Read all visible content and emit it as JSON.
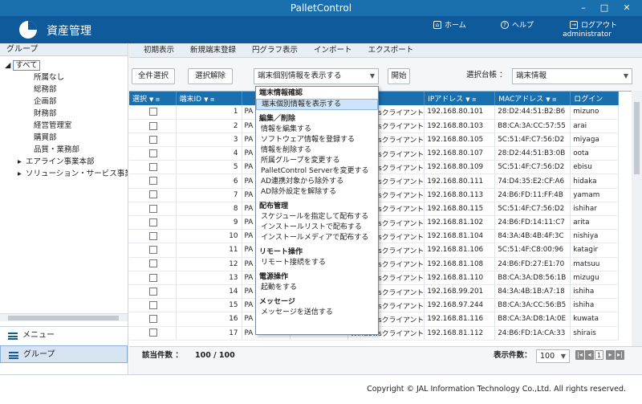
{
  "window": {
    "title": "PalletControl",
    "minimize": "–",
    "maximize": "□",
    "close": "✕"
  },
  "header": {
    "app_title": "資産管理",
    "home": "ホーム",
    "help": "ヘルプ",
    "logout": "ログアウト",
    "user": "administrator"
  },
  "sidebar": {
    "title": "グループ",
    "tree_root": "すべて",
    "children": [
      "所属なし",
      "総務部",
      "企画部",
      "財務部",
      "経営管理室",
      "購買部",
      "品質・業務部"
    ],
    "expandable": [
      "エアライン事業本部",
      "ソリューション・サービス事業本部"
    ],
    "menu_label": "メニュー",
    "group_label": "グループ"
  },
  "menubar": [
    "初期表示",
    "新規端末登録",
    "円グラフ表示",
    "インポート",
    "エクスポート"
  ],
  "toolbar": {
    "select_all": "全件選択",
    "deselect": "選択解除",
    "action_combo": "端末個別情報を表示する",
    "start": "開始",
    "ledger_label": "選択台帳 ：",
    "ledger_value": "端末情報"
  },
  "grid": {
    "headers": [
      "選択",
      "端末ID",
      "",
      "",
      "種別",
      "IPアドレス",
      "MACアドレス",
      "ログイン"
    ],
    "rows": [
      {
        "id": "1",
        "a": "PA",
        "type": "Windowsクライアント",
        "ip": "192.168.80.101",
        "mac": "28:D2:44:51:B2:B6",
        "login": "mizuno"
      },
      {
        "id": "2",
        "a": "PA",
        "type": "Windowsクライアント",
        "ip": "192.168.80.103",
        "mac": "B8:CA:3A:CC:57:55",
        "login": "arai"
      },
      {
        "id": "3",
        "a": "PA",
        "type": "Windowsクライアント",
        "ip": "192.168.80.105",
        "mac": "5C:51:4F:C7:56:D2",
        "login": "miyaga"
      },
      {
        "id": "4",
        "a": "PA",
        "type": "Windowsクライアント",
        "ip": "192.168.80.107",
        "mac": "28:D2:44:51:B3:0B",
        "login": "oota"
      },
      {
        "id": "5",
        "a": "PA",
        "type": "Windowsクライアント",
        "ip": "192.168.80.109",
        "mac": "5C:51:4F:C7:56:D2",
        "login": "ebisu"
      },
      {
        "id": "6",
        "a": "PA",
        "type": "Windowsクライアント",
        "ip": "192.168.80.111",
        "mac": "74:D4:35:E2:CF:A6",
        "login": "hidaka"
      },
      {
        "id": "7",
        "a": "PA",
        "type": "Windowsクライアント",
        "ip": "192.168.80.113",
        "mac": "24:B6:FD:11:FF:4B",
        "login": "yamam"
      },
      {
        "id": "8",
        "a": "PA",
        "type": "Windowsクライアント",
        "ip": "192.168.80.115",
        "mac": "5C:51:4F:C7:56:D2",
        "login": "ishihar"
      },
      {
        "id": "9",
        "a": "PA",
        "type": "Windowsクライアント",
        "ip": "192.168.81.102",
        "mac": "24:B6:FD:14:11:C7",
        "login": "arita"
      },
      {
        "id": "10",
        "a": "PA",
        "type": "Windowsクライアント",
        "ip": "192.168.81.104",
        "mac": "84:3A:4B:4B:4F:3C",
        "login": "nishiya"
      },
      {
        "id": "11",
        "a": "PA",
        "type": "Windowsクライアント",
        "ip": "192.168.81.106",
        "mac": "5C:51:4F:C8:00:96",
        "login": "katagir"
      },
      {
        "id": "12",
        "a": "PA",
        "type": "Windowsクライアント",
        "ip": "192.168.81.108",
        "mac": "24:B6:FD:27:E1:70",
        "login": "matsuu"
      },
      {
        "id": "13",
        "a": "PA",
        "type": "Windowsクライアント",
        "ip": "192.168.81.110",
        "mac": "B8:CA:3A:D8:56:1B",
        "login": "mizugu"
      },
      {
        "id": "14",
        "a": "PA",
        "type": "Windowsクライアント",
        "ip": "192.168.99.201",
        "mac": "84:3A:4B:1B:A7:18",
        "login": "ishiha"
      },
      {
        "id": "15",
        "a": "PA",
        "type": "Windowsクライアント",
        "ip": "192.168.97.244",
        "mac": "B8:CA:3A:CC:56:B5",
        "login": "ishiha"
      },
      {
        "id": "16",
        "a": "PA",
        "type": "Windowsクライアント",
        "ip": "192.168.81.116",
        "mac": "B8:CA:3A:D8:1A:0E",
        "login": "kuwata"
      },
      {
        "id": "17",
        "a": "PA",
        "type": "Windowsクライアント",
        "ip": "192.168.81.112",
        "mac": "24:B6:FD:1A:CA:33",
        "login": "shirais"
      }
    ]
  },
  "dropdown": [
    {
      "group": "端末情報確認",
      "items": [
        "端末個別情報を表示する"
      ]
    },
    {
      "group": "編集／削除",
      "items": [
        "情報を編集する",
        "ソフトウェア情報を登録する",
        "情報を削除する",
        "所属グループを変更する",
        "PalletControl Serverを変更する",
        "AD連携対象から除外する",
        "AD除外設定を解除する"
      ]
    },
    {
      "group": "配布管理",
      "items": [
        "スケジュールを指定して配布する",
        "インストールリストで配布する",
        "インストールメディアで配布する"
      ]
    },
    {
      "group": "リモート操作",
      "items": [
        "リモート接続をする"
      ]
    },
    {
      "group": "電源操作",
      "items": [
        "起動をする"
      ]
    },
    {
      "group": "メッセージ",
      "items": [
        "メッセージを送信する"
      ]
    }
  ],
  "status": {
    "count_label": "該当件数 ：",
    "count_value": "100 / 100",
    "per_page_label": "表示件数：",
    "per_page_value": "100",
    "page": "1"
  },
  "footer": {
    "copyright": "Copyright © JAL Information Technology Co.,Ltd. All rights reserved."
  },
  "colors": {
    "titlebar": "#1a6fae",
    "header": "#0f5a9a",
    "grid_header": "#1a6fae"
  }
}
